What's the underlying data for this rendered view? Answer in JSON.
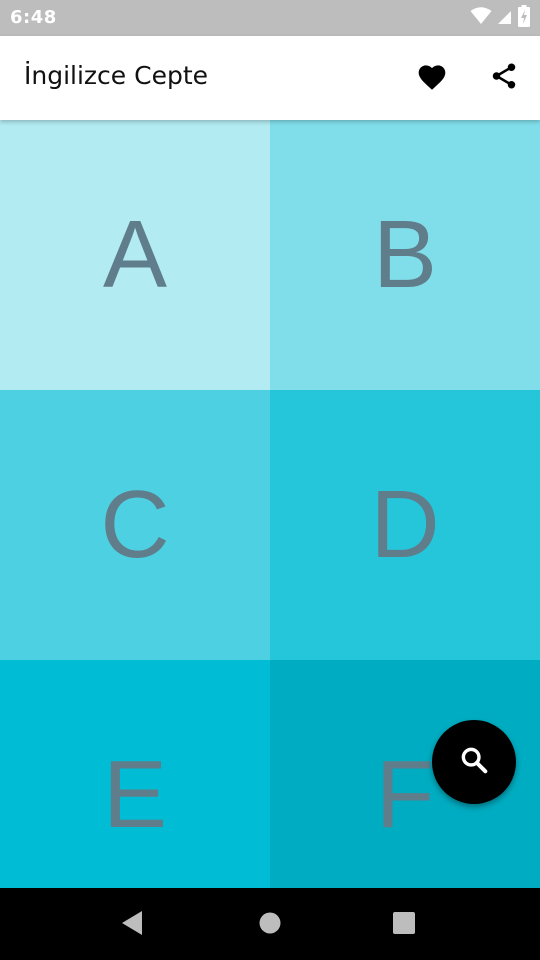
{
  "status_bar": {
    "time": "6:48",
    "icons": [
      "wifi-icon",
      "signal-icon",
      "battery-charging-icon"
    ],
    "icon_color": "#ffffff",
    "background": "#bdbdbd"
  },
  "app_bar": {
    "title": "İngilizce Cepte",
    "actions": [
      "heart-icon",
      "share-icon"
    ]
  },
  "tiles": [
    {
      "letter": "A",
      "color": "#b2ebf2"
    },
    {
      "letter": "B",
      "color": "#80deea"
    },
    {
      "letter": "C",
      "color": "#4dd0e1"
    },
    {
      "letter": "D",
      "color": "#26c6da"
    },
    {
      "letter": "E",
      "color": "#00bcd4"
    },
    {
      "letter": "F",
      "color": "#00acc1"
    }
  ],
  "letter_color": "#607d8b",
  "fab": {
    "icon": "search-icon",
    "color": "#000000"
  },
  "nav_bar": {
    "buttons": [
      "back-icon",
      "home-icon",
      "recents-icon"
    ]
  }
}
